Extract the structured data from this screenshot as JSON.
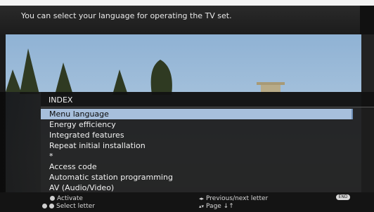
{
  "info_bar": {
    "text": "You can select your language for operating the TV set."
  },
  "index_panel": {
    "title": "INDEX",
    "items": [
      {
        "label": "Menu language",
        "selected": true
      },
      {
        "label": "Energy efficiency",
        "selected": false
      },
      {
        "label": "Integrated features",
        "selected": false
      },
      {
        "label": "Repeat initial installation",
        "selected": false
      },
      {
        "label": "*",
        "selected": false
      },
      {
        "label": "Access code",
        "selected": false
      },
      {
        "label": "Automatic station programming",
        "selected": false
      },
      {
        "label": "AV (Audio/Video)",
        "selected": false
      }
    ]
  },
  "footer": {
    "activate": "Activate",
    "select_letter": "Select letter",
    "prev_next_letter": "Previous/next letter",
    "page": "Page ↓↑",
    "end": "END"
  },
  "colors": {
    "selection_highlight": "#a7bfdc",
    "panel_bg": "#1e1e1e",
    "footer_bg": "#141414"
  }
}
